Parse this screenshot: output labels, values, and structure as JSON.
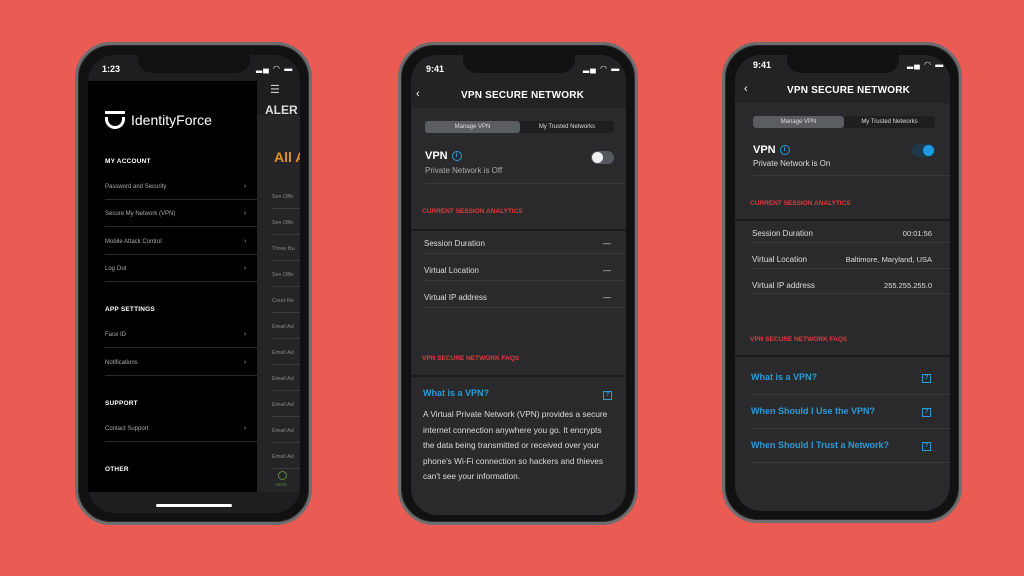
{
  "colors": {
    "background": "#E95B53",
    "accent_red": "#E2393C",
    "link_blue": "#2B9BD6",
    "toggle_on": "#1E9BE0",
    "alert_orange": "#E0902A"
  },
  "phone1": {
    "status_time": "1:23",
    "brand": "IdentityForce",
    "sections": [
      {
        "title": "MY ACCOUNT",
        "items": [
          "Password and Security",
          "Secure My Network (VPN)",
          "Mobile Attack Control",
          "Log Out"
        ]
      },
      {
        "title": "APP SETTINGS",
        "items": [
          "Face ID",
          "Notifications"
        ]
      },
      {
        "title": "SUPPORT",
        "items": [
          "Contact Support"
        ]
      },
      {
        "title": "OTHER",
        "items": []
      }
    ],
    "behind": {
      "title": "ALER",
      "subtitle": "All A",
      "rows": [
        "Sex Offe",
        "Sex Offe",
        "Three Bu",
        "Sex Offe",
        "Court Re",
        "Email Ad",
        "Email Ad",
        "Email Ad",
        "Email Ad",
        "Email Ad",
        "Email Ad"
      ],
      "tab": "Alerts"
    }
  },
  "phone2": {
    "status_time": "9:41",
    "title": "VPN SECURE NETWORK",
    "tabs": [
      "Manage VPN",
      "My Trusted Networks"
    ],
    "vpn_label": "VPN",
    "vpn_status": "Private Network is Off",
    "vpn_on": false,
    "analytics_title": "CURRENT SESSION ANALYTICS",
    "rows": [
      {
        "label": "Session Duration",
        "value": "—"
      },
      {
        "label": "Virtual Location",
        "value": "—"
      },
      {
        "label": "Virtual IP address",
        "value": "—"
      }
    ],
    "faq_title": "VPN SECURE NETWORK FAQS",
    "faq_question": "What is a VPN?",
    "faq_answer": "A Virtual Private Network (VPN) provides a secure internet connection anywhere you go. It encrypts the data being transmitted or received over your phone's Wi-Fi connection so hackers and thieves can't see your information."
  },
  "phone3": {
    "status_time": "9:41",
    "title": "VPN SECURE NETWORK",
    "tabs": [
      "Manage VPN",
      "My Trusted Networks"
    ],
    "vpn_label": "VPN",
    "vpn_status": "Private Network is On",
    "vpn_on": true,
    "analytics_title": "CURRENT SESSION ANALYTICS",
    "rows": [
      {
        "label": "Session Duration",
        "value": "00:01:56"
      },
      {
        "label": "Virtual Location",
        "value": "Baltimore, Maryland, USA"
      },
      {
        "label": "Virtual IP address",
        "value": "255.255.255.0"
      }
    ],
    "faq_title": "VPN SECURE NETWORK FAQS",
    "faqs": [
      "What is a VPN?",
      "When Should I Use the VPN?",
      "When Should I Trust a Network?"
    ]
  }
}
